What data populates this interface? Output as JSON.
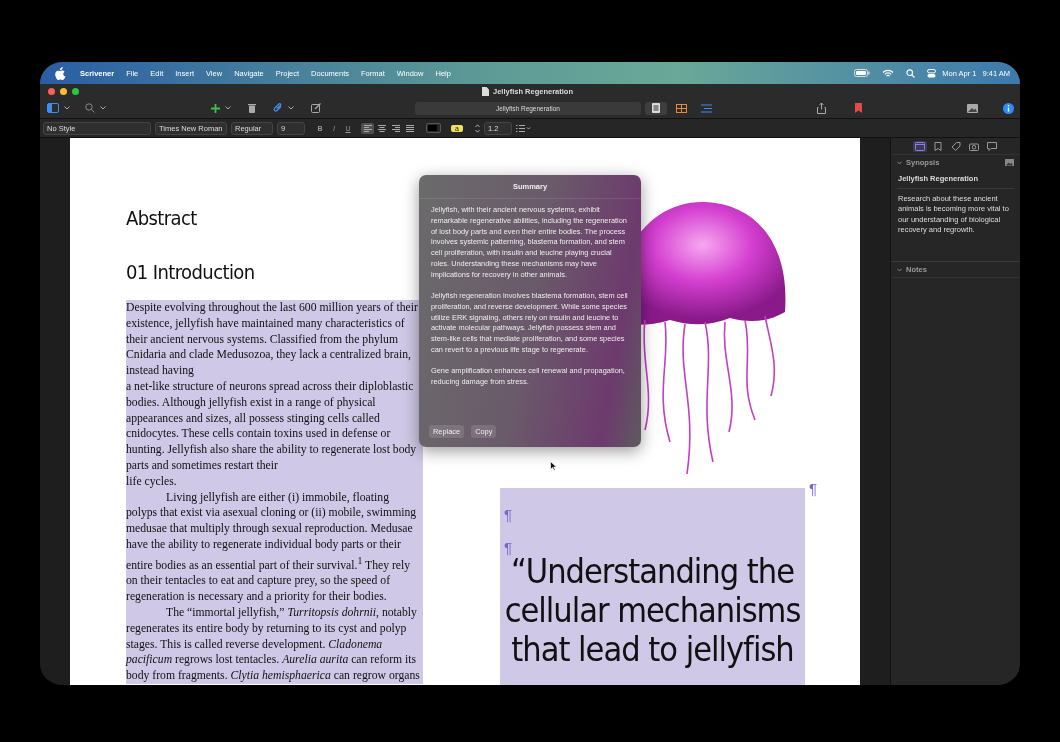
{
  "menu_bar": {
    "app": "Scrivener",
    "items": [
      "File",
      "Edit",
      "Insert",
      "View",
      "Navigate",
      "Project",
      "Documents",
      "Format",
      "Window",
      "Help"
    ],
    "date": "Mon Apr 1",
    "time": "9:41 AM"
  },
  "window": {
    "title": "Jellyfish Regeneration"
  },
  "toolbar": {
    "document_field": "Jellyfish Regeneration",
    "view_modes": [
      {
        "kind": "document",
        "selected": true
      },
      {
        "kind": "corkboard",
        "selected": false
      },
      {
        "kind": "outline",
        "selected": false
      }
    ]
  },
  "format_bar": {
    "style": "No Style",
    "font": "Times New Roman",
    "face": "Regular",
    "size": "9",
    "text_styles": [
      "B",
      "I",
      "U"
    ],
    "alignments": [
      {
        "kind": "left",
        "selected": true
      },
      {
        "kind": "center",
        "selected": false
      },
      {
        "kind": "right",
        "selected": false
      },
      {
        "kind": "justify",
        "selected": false
      }
    ],
    "highlight": "a",
    "line_spacing": "1.2"
  },
  "editor": {
    "selected": true,
    "headings": [
      "Abstract",
      "01 Introduction"
    ],
    "paragraphs": [
      {
        "indent": false,
        "text": "Despite evolving throughout the last 600 million years of their existence, jellyfish have maintained many characteristics of their ancient nervous systems. Classified from the phylum Cnidaria and clade Medusozoa, they lack a centralized brain, instead having\na net-like structure of neurons spread across their diploblastic bodies. Although jellyfish exist in a range of physical appearances and sizes, all possess stinging cells called cnidocytes. These cells contain toxins used in defense or hunting. Jellyfish also share the ability to regenerate lost body parts and sometimes restart their\nlife cycles."
      },
      {
        "indent": true,
        "text": "Living jellyfish are either (i) immobile, floating polyps that exist via asexual cloning or (ii) mobile, swimming medusae that multiply through sexual reproduction. Medusae have the ability to regenerate individual body parts or their entire bodies as an essential part of their survival.$^{1}$ They rely on their tentacles to eat and capture prey, so the speed of regeneration is necessary and a priority for their bodies."
      },
      {
        "indent": true,
        "text": "The “immortal jellyfish,” *Turritopsis dohrnii*, notably regenerates its entire body by returning to its cyst and polyp stages. This is called reverse development. *Cladonema pacificum* regrows lost tentacles. *Aurelia aurita* can reform its body from fragments. *Clytia hemisphaerica* can regrow organs"
      }
    ],
    "image_mark": "¶",
    "quote_marks": [
      "¶",
      "¶"
    ],
    "quote": "“Understanding the\ncellular mechanisms\nthat lead to jellyfish"
  },
  "summary": {
    "title": "Summary",
    "paragraphs": [
      "Jellyfish, with their ancient nervous systems, exhibit remarkable regenerative abilities, including the regeneration of lost body parts and even their entire bodies. The process involves systemic patterning, blastema formation, and stem cell proliferation, with insulin and leucine playing crucial roles. Understanding these mechanisms may have implications for recovery in other animals.",
      "Jellyfish regeneration involves blastema formation, stem cell proliferation, and reverse development. While some species utilize ERK signaling, others rely on insulin and leucine to activate molecular pathways. Jellyfish possess stem and stem-like cells that mediate proliferation, and some species can revert to a previous life stage to regenerate.",
      "Gene amplification enhances cell renewal and propagation, reducing damage from stress."
    ],
    "buttons": [
      "Replace",
      "Copy"
    ]
  },
  "inspector": {
    "tabs": [
      {
        "kind": "synopsis",
        "selected": true
      },
      {
        "kind": "bookmarks",
        "selected": false
      },
      {
        "kind": "metadata",
        "selected": false
      },
      {
        "kind": "snapshots",
        "selected": false
      },
      {
        "kind": "comments",
        "selected": false
      }
    ],
    "synopsis": {
      "label": "Synopsis",
      "title": "Jellyfish Regeneration",
      "text": "Research about these ancient animals is becoming more vital to our understanding of biological recovery and regrowth."
    },
    "notes": {
      "label": "Notes"
    }
  }
}
